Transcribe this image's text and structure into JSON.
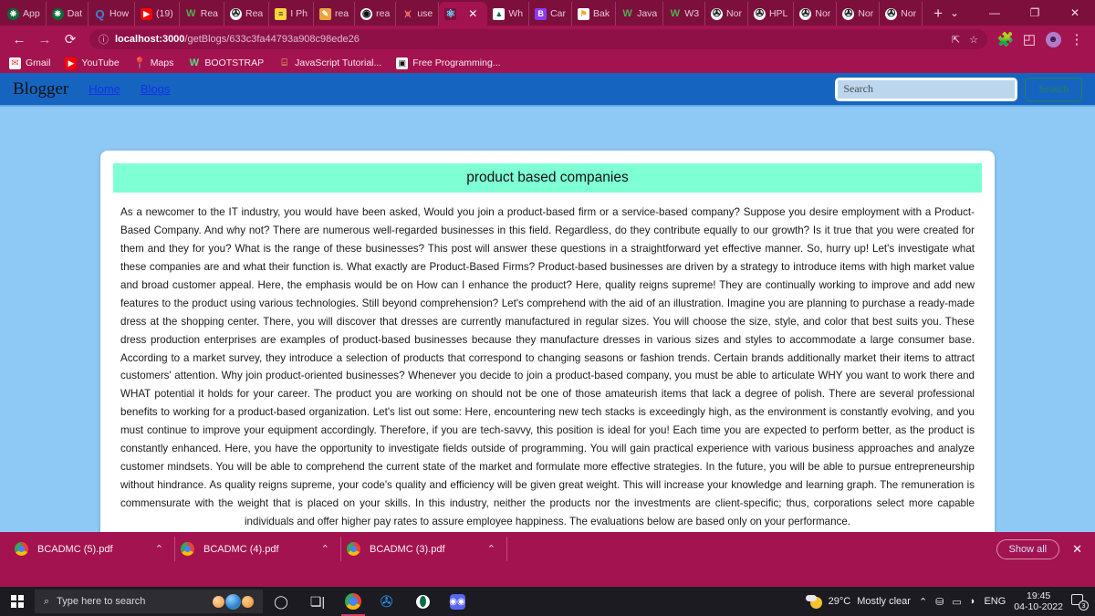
{
  "browser": {
    "tabs": [
      {
        "label": "App",
        "icon": "leaf-icon",
        "active": false
      },
      {
        "label": "Dat",
        "icon": "leaf-icon",
        "active": false
      },
      {
        "label": "How",
        "icon": "quora-icon",
        "active": false
      },
      {
        "label": "(19)",
        "icon": "youtube-icon",
        "active": false
      },
      {
        "label": "Rea",
        "icon": "w3schools-icon",
        "active": false
      },
      {
        "label": "Rea",
        "icon": "globe-icon",
        "active": false
      },
      {
        "label": "I Ph",
        "icon": "note-icon",
        "active": false
      },
      {
        "label": "rea",
        "icon": "medium-icon",
        "active": false
      },
      {
        "label": "rea",
        "icon": "github-icon",
        "active": false
      },
      {
        "label": "use",
        "icon": "npm-icon",
        "active": false
      },
      {
        "label": "",
        "icon": "react-icon",
        "active": true
      },
      {
        "label": "Wh",
        "icon": "material-icon",
        "active": false
      },
      {
        "label": "Car",
        "icon": "b-icon",
        "active": false
      },
      {
        "label": "Bak",
        "icon": "bakery-icon",
        "active": false
      },
      {
        "label": "Java",
        "icon": "w3schools-icon",
        "active": false
      },
      {
        "label": "W3",
        "icon": "w3schools-icon",
        "active": false
      },
      {
        "label": "Nor",
        "icon": "globe-icon",
        "active": false
      },
      {
        "label": "HPL",
        "icon": "globe-icon",
        "active": false
      },
      {
        "label": "Nor",
        "icon": "globe-icon",
        "active": false
      },
      {
        "label": "Nor",
        "icon": "globe-icon",
        "active": false
      },
      {
        "label": "Nor",
        "icon": "globe-icon",
        "active": false
      }
    ],
    "new_tab_label": "+",
    "window_controls": {
      "collapse": "⌄",
      "minimize": "—",
      "maximize": "❐",
      "close": "✕"
    },
    "toolbar": {
      "back": "←",
      "forward": "→",
      "reload": "⟳",
      "site_info": "ⓘ",
      "url_host": "localhost:3000",
      "url_path": "/getBlogs/633c3fa44793a908c98ede26",
      "share": "⇱",
      "bookmark_star": "☆",
      "extensions": "🧩",
      "split_screen": "◰",
      "profile": "☻",
      "menu": "⋮"
    },
    "bookmarks": [
      {
        "label": "Gmail",
        "icon": "gmail-icon"
      },
      {
        "label": "YouTube",
        "icon": "youtube-icon"
      },
      {
        "label": "Maps",
        "icon": "maps-pin-icon"
      },
      {
        "label": "BOOTSTRAP",
        "icon": "w3schools-icon"
      },
      {
        "label": "JavaScript Tutorial...",
        "icon": "js-icon"
      },
      {
        "label": "Free Programming...",
        "icon": "window-icon"
      }
    ],
    "downloads": {
      "items": [
        {
          "filename": "BCADMC (5).pdf",
          "chevron": "⌃"
        },
        {
          "filename": "BCADMC (4).pdf",
          "chevron": "⌃"
        },
        {
          "filename": "BCADMC (3).pdf",
          "chevron": "⌃"
        }
      ],
      "show_all": "Show all",
      "close": "✕"
    }
  },
  "page": {
    "brand": "Blogger",
    "nav_links": [
      "Home",
      "Blogs"
    ],
    "search": {
      "placeholder": "Search",
      "value": "Search",
      "button_label": "Search"
    },
    "post": {
      "title": "product based companies",
      "body": "As a newcomer to the IT industry, you would have been asked, Would you join a product-based firm or a service-based company? Suppose you desire employment with a Product-Based Company. And why not? There are numerous well-regarded businesses in this field. Regardless, do they contribute equally to our growth? Is it true that you were created for them and they for you? What is the range of these businesses? This post will answer these questions in a straightforward yet effective manner. So, hurry up! Let's investigate what these companies are and what their function is. What exactly are Product-Based Firms? Product-based businesses are driven by a strategy to introduce items with high market value and broad customer appeal. Here, the emphasis would be on How can I enhance the product? Here, quality reigns supreme! They are continually working to improve and add new features to the product using various technologies. Still beyond comprehension? Let's comprehend with the aid of an illustration. Imagine you are planning to purchase a ready-made dress at the shopping center. There, you will discover that dresses are currently manufactured in regular sizes. You will choose the size, style, and color that best suits you. These dress production enterprises are examples of product-based businesses because they manufacture dresses in various sizes and styles to accommodate a large consumer base. According to a market survey, they introduce a selection of products that correspond to changing seasons or fashion trends. Certain brands additionally market their items to attract customers' attention. Why join product-oriented businesses? Whenever you decide to join a product-based company, you must be able to articulate WHY you want to work there and WHAT potential it holds for your career. The product you are working on should not be one of those amateurish items that lack a degree of polish. There are several professional benefits to working for a product-based organization. Let's list out some: Here, encountering new tech stacks is exceedingly high, as the environment is constantly evolving, and you must continue to improve your equipment accordingly. Therefore, if you are tech-savvy, this position is ideal for you! Each time you are expected to perform better, as the product is constantly enhanced. Here, you have the opportunity to investigate fields outside of programming. You will gain practical experience with various business approaches and analyze customer mindsets. You will be able to comprehend the current state of the market and formulate more effective strategies. In the future, you will be able to pursue entrepreneurship without hindrance. As quality reigns supreme, your code's quality and efficiency will be given great weight. This will increase your knowledge and learning graph. The remuneration is commensurate with the weight that is placed on your skills. In this industry, neither the products nor the investments are client-specific; thus, corporations select more capable individuals and offer higher pay rates to assure employee happiness. The evaluations below are based only on your performance."
    },
    "colors": {
      "navbar": "#1565C0",
      "page_background": "#8EC9F5",
      "title_background": "#7FFFD4",
      "browser_chrome": "#A3134F"
    }
  },
  "taskbar": {
    "start": "start-button",
    "search_placeholder": "Type here to search",
    "apps": [
      {
        "name": "cortana-icon"
      },
      {
        "name": "task-view-icon"
      },
      {
        "name": "chrome-icon"
      },
      {
        "name": "vscode-icon"
      },
      {
        "name": "opera-icon"
      },
      {
        "name": "discord-icon"
      }
    ],
    "tray": {
      "temperature": "29°C",
      "condition": "Mostly clear",
      "chevron": "⌃",
      "ENG": "ENG",
      "time": "19:45",
      "date": "04-10-2022",
      "notification_count": "3"
    }
  }
}
